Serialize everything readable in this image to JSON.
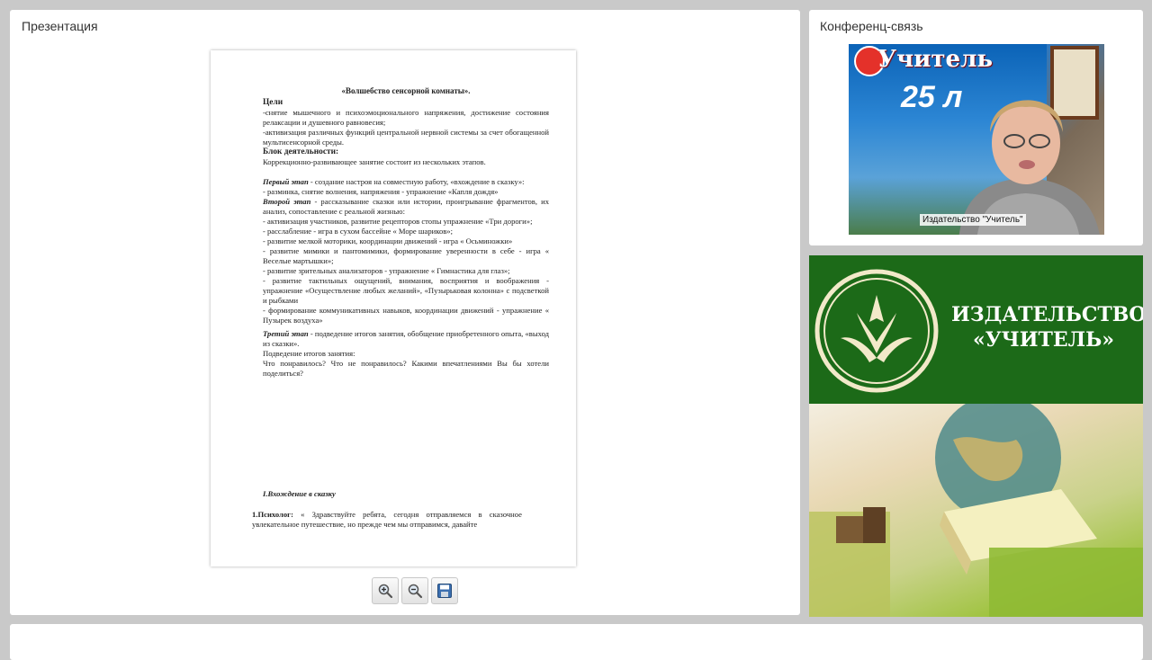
{
  "presentation": {
    "title": "Презентация",
    "document": {
      "doc_title": "«Волшебство сенсорной комнаты».",
      "goals_heading": "Цели",
      "goals": [
        "-снятие мышечного и психоэмоционального напряжения, достижение состояния релаксации и душевного равновесия;",
        "-активизация различных функций центральной нервной системы за счет обогащенной мультисенсорной среды."
      ],
      "block_heading": "Блок деятельности:",
      "block_text": "Коррекционно-развивающее занятие состоит из нескольких этапов.",
      "stage1_label": "Первый этап",
      "stage1_text": " - создание настроя на совместную работу, «вхождение в сказку»:",
      "stage1_items": [
        "- разминка, снятие волнения, напряжения - упражнение «Капля дождя»"
      ],
      "stage2_label": "Второй этап",
      "stage2_text": " - рассказывание сказки или истории, проигрывание фрагментов, их анализ, сопоставление с реальной жизнью:",
      "stage2_items": [
        "- активизация участников, развитие рецепторов стопы упражнение «Три дороги»;",
        "- расслабление - игра в сухом бассейне « Море шариков»;",
        "- развитие мелкой моторики, координации движений - игра « Осьминожки»",
        "- развитие мимики и пантомимики, формирование уверенности в себе - игра « Веселые мартышки»;",
        "- развитие зрительных анализаторов - упражнение « Гимнастика для глаз»;",
        "- развитие тактильных ощущений, внимания, восприятия и воображения - упражнение «Осуществление любых желаний», «Пузырьковая колонна» с подсветкой и рыбками",
        "- формирование коммуникативных навыков, координации движений - упражнение « Пузырек воздуха»"
      ],
      "stage3_label": "Третий этап",
      "stage3_text": " - подведение итогов занятия, обобщение приобретенного опыта, «выход из сказки».",
      "summary": "Подведение итогов занятия:",
      "questions": "Что понравилось? Что не понравилось? Какими впечатлениями Вы бы хотели поделиться?",
      "section": "I.Вхождение в сказку",
      "psychologist_label": "1.Психолог:",
      "psychologist_text": " « Здравствуйте ребята, сегодня отправляемся в сказочное увлекательное путешествие, но прежде чем мы отправимся, давайте"
    },
    "toolbar": {
      "zoom_in_icon": "zoom-in-icon",
      "zoom_out_icon": "zoom-out-icon",
      "save_icon": "save-icon"
    }
  },
  "conference": {
    "title": "Конференц-связь",
    "video": {
      "poster_text": "Учитель",
      "poster_number": "25 л",
      "caption": "Издательство \"Учитель\""
    }
  },
  "brand": {
    "line1": "ИЗДАТЕЛЬСТВО",
    "line2": "«УЧИТЕЛЬ»",
    "accent": "#1f6e1b"
  }
}
